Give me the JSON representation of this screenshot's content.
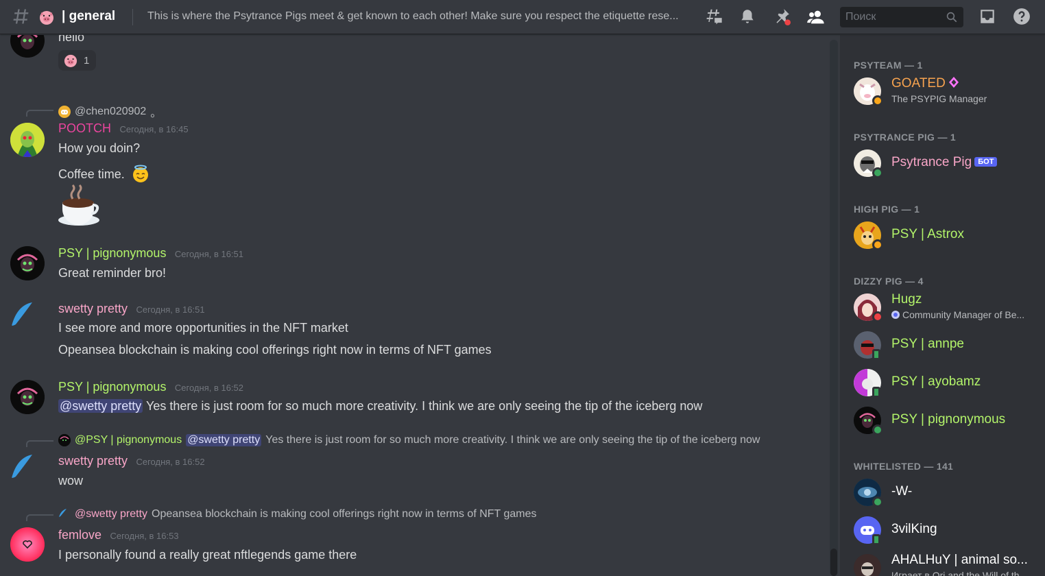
{
  "header": {
    "channel_name": "| general",
    "topic": "This is where the Psytrance Pigs meet & get known to each other! Make sure you respect the etiquette rese...",
    "search_placeholder": "Поиск"
  },
  "colors": {
    "pink": "#eb459e",
    "green": "#b3f46a",
    "orange": "#f7a34f",
    "light_pink": "#f9a6c8",
    "mention_bg": "#414675"
  },
  "messages": {
    "m1": {
      "text": "hello",
      "reaction_count": "1"
    },
    "m2": {
      "reply_user": "@chen020902",
      "reply_suffix": "。",
      "user": "POOTCH",
      "time": "Сегодня, в 16:45",
      "lines": [
        "How you doin?",
        "Coffee time."
      ]
    },
    "m3": {
      "user": "PSY | pignonymous",
      "time": "Сегодня, в 16:51",
      "text": "Great reminder bro!"
    },
    "m4": {
      "user": "swetty pretty",
      "time": "Сегодня, в 16:51",
      "lines": [
        "I see more and more opportunities in the NFT market",
        "Opeansea blockchain is making cool offerings right now in terms of NFT games"
      ]
    },
    "m5": {
      "user": "PSY | pignonymous",
      "time": "Сегодня, в 16:52",
      "mention": "@swetty pretty",
      "text": " Yes there is just room for so much more creativity. I think we are only seeing the tip of the iceberg now"
    },
    "m6": {
      "reply_user": "@PSY | pignonymous",
      "reply_mention": "@swetty pretty",
      "reply_text": "Yes there is just room for so much more creativity. I think we are only seeing the tip of the iceberg now",
      "user": "swetty pretty",
      "time": "Сегодня, в 16:52",
      "text": "wow"
    },
    "m7": {
      "reply_user": "@swetty pretty",
      "reply_text": "Opeansea blockchain is making cool offerings right now in terms of NFT games",
      "user": "femlove",
      "time": "Сегодня, в 16:53",
      "text": "I personally found a really great nftlegends game there"
    }
  },
  "members": {
    "psyteam": {
      "role": "PSYTEAM — 1",
      "name": "GOATED",
      "sub": "The PSYPIG Manager"
    },
    "psytrance_pig": {
      "role": "PSYTRANCE PIG — 1",
      "name": "Psytrance Pig",
      "tag": "БОТ"
    },
    "high_pig": {
      "role": "HIGH PIG — 1",
      "name": "PSY | Astrox"
    },
    "dizzy_pig": {
      "role": "DIZZY PIG — 4",
      "items": [
        {
          "name": "Hugz",
          "sub": "Community Manager of Be..."
        },
        {
          "name": "PSY | annpe"
        },
        {
          "name": "PSY | ayobamz"
        },
        {
          "name": "PSY | pignonymous"
        }
      ]
    },
    "whitelisted": {
      "role": "WHITELISTED — 141",
      "items": [
        {
          "name": "-W-"
        },
        {
          "name": "3vilKing"
        },
        {
          "name": "AHALHuY | animal so...",
          "sub": "Играет в Ori and the Will of th..."
        }
      ]
    }
  }
}
